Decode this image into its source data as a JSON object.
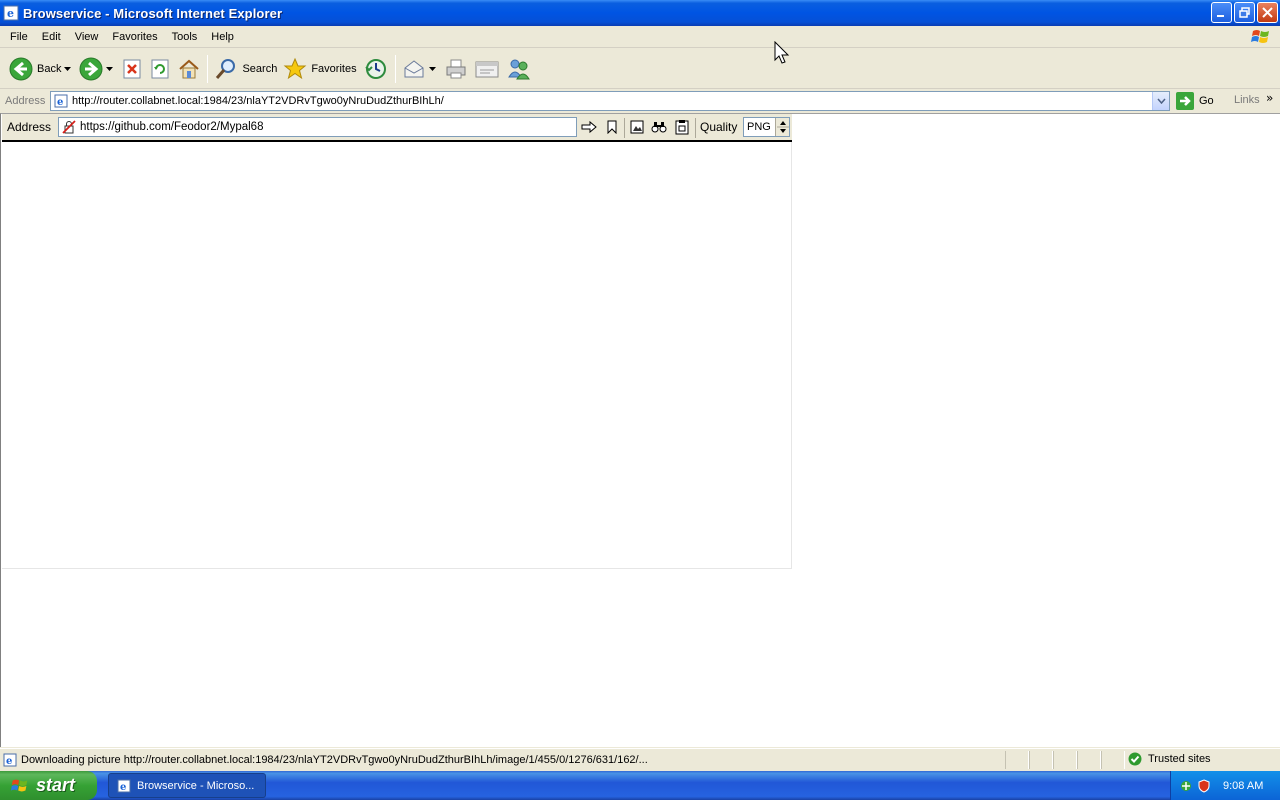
{
  "window": {
    "title": "Browservice - Microsoft Internet Explorer"
  },
  "menu": [
    "File",
    "Edit",
    "View",
    "Favorites",
    "Tools",
    "Help"
  ],
  "toolbar": {
    "back_label": "Back",
    "search_label": "Search",
    "favorites_label": "Favorites"
  },
  "address_bar": {
    "label": "Address",
    "url": "http://router.collabnet.local:1984/23/nlaYT2VDRvTgwo0yNruDudZthurBIhLh/",
    "go_label": "Go",
    "links_label": "Links"
  },
  "browservice": {
    "address_label": "Address",
    "url": "https://github.com/Feodor2/Mypal68",
    "quality_label": "Quality",
    "quality_value": "PNG"
  },
  "status_bar": {
    "text": "Downloading picture http://router.collabnet.local:1984/23/nlaYT2VDRvTgwo0yNruDudZthurBIhLh/image/1/455/0/1276/631/162/...",
    "zone_label": "Trusted sites"
  },
  "taskbar": {
    "start_label": "start",
    "task_label": "Browservice - Microso...",
    "clock": "9:08 AM"
  },
  "colors": {
    "titlebar": "#0054e3",
    "taskbar": "#2157d7",
    "start_button": "#36a235",
    "chrome": "#ece9d8"
  }
}
